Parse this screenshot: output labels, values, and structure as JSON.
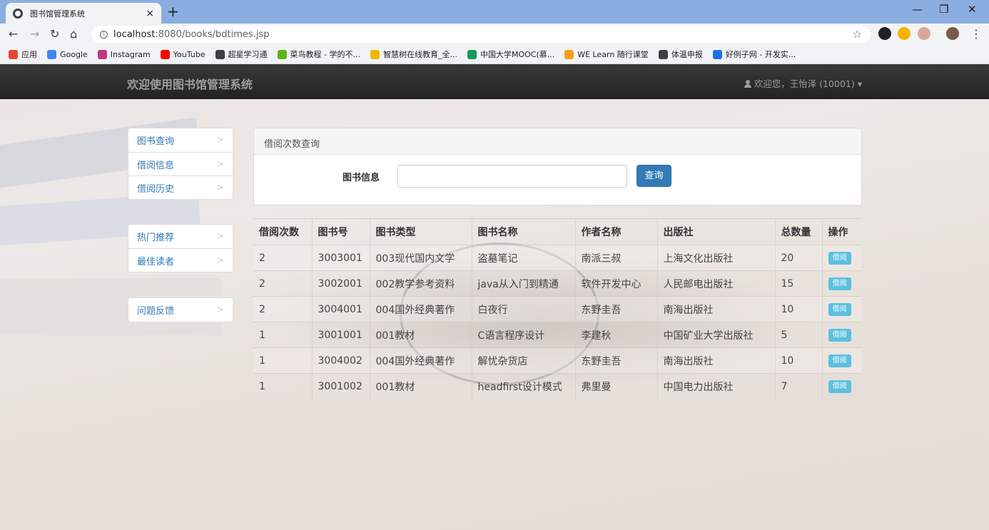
{
  "browser": {
    "tab_title": "图书馆管理系统",
    "tab_close": "×",
    "new_tab": "+",
    "url_host": "localhost",
    "url_path": ":8080/books/bdtimes.jsp",
    "bookmarks": [
      {
        "label": "应用",
        "color": "#ea4335"
      },
      {
        "label": "Google",
        "color": "#4285f4"
      },
      {
        "label": "Instagram",
        "color": "#c13584"
      },
      {
        "label": "YouTube",
        "color": "#ff0000"
      },
      {
        "label": "超星学习通",
        "color": "#3c4043"
      },
      {
        "label": "菜鸟教程 - 学的不...",
        "color": "#5fb41a"
      },
      {
        "label": "智慧树在线教育_全...",
        "color": "#f4b400"
      },
      {
        "label": "中国大学MOOC(慕...",
        "color": "#0f9d58"
      },
      {
        "label": "WE Learn 随行课堂",
        "color": "#f4a21b"
      },
      {
        "label": "体温申报",
        "color": "#3c4043"
      },
      {
        "label": "好例子网 - 开发实...",
        "color": "#1a73e8"
      }
    ]
  },
  "header": {
    "brand": "欢迎使用图书馆管理系统",
    "user": "欢迎您，王怡泽 (10001) ▾"
  },
  "sidebar": {
    "group1": [
      {
        "label": "图书查询"
      },
      {
        "label": "借阅信息"
      },
      {
        "label": "借阅历史"
      }
    ],
    "group2": [
      {
        "label": "热门推荐"
      },
      {
        "label": "最佳读者"
      }
    ],
    "group3": [
      {
        "label": "问题反馈"
      }
    ],
    "chevron": ">"
  },
  "search_panel": {
    "title": "借阅次数查询",
    "label": "图书信息",
    "input_value": "",
    "button": "查询"
  },
  "table": {
    "headers": [
      "借阅次数",
      "图书号",
      "图书类型",
      "图书名称",
      "作者名称",
      "出版社",
      "总数量",
      "操作"
    ],
    "action_label": "借阅",
    "rows": [
      [
        "2",
        "3003001",
        "003现代国内文学",
        "盗墓笔记",
        "南派三叔",
        "上海文化出版社",
        "20"
      ],
      [
        "2",
        "3002001",
        "002教学参考资料",
        "java从入门到精通",
        "软件开发中心",
        "人民邮电出版社",
        "15"
      ],
      [
        "2",
        "3004001",
        "004国外经典著作",
        "白夜行",
        "东野圭吾",
        "南海出版社",
        "10"
      ],
      [
        "1",
        "3001001",
        "001教材",
        "C语言程序设计",
        "李建秋",
        "中国矿业大学出版社",
        "5"
      ],
      [
        "1",
        "3004002",
        "004国外经典著作",
        "解忧杂货店",
        "东野圭吾",
        "南海出版社",
        "10"
      ],
      [
        "1",
        "3001002",
        "001教材",
        "headfirst设计模式",
        "弗里曼",
        "中国电力出版社",
        "7"
      ]
    ]
  },
  "colors": {
    "link": "#337ab7",
    "primary_button": "#337ab7",
    "info_button": "#5bc0de",
    "navbar": "#222222"
  }
}
